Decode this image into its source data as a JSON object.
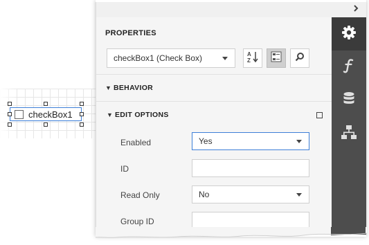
{
  "design_surface": {
    "control_label": "checkBox1"
  },
  "panel": {
    "collapse_icon": "chevron-right-icon",
    "title": "PROPERTIES",
    "object_selector": {
      "value": "checkBox1 (Check Box)"
    },
    "toolbar": {
      "sort_icon": "sort-alphabetical-icon",
      "categories_icon": "categorized-view-icon",
      "search_icon": "search-icon"
    },
    "sections": [
      {
        "name": "BEHAVIOR",
        "expanded": false
      },
      {
        "name": "EDIT OPTIONS",
        "expanded": true
      }
    ],
    "properties": [
      {
        "label": "Enabled",
        "value": "Yes",
        "type": "dropdown"
      },
      {
        "label": "ID",
        "value": "",
        "type": "text"
      },
      {
        "label": "Read Only",
        "value": "No",
        "type": "dropdown"
      },
      {
        "label": "Group ID",
        "value": "",
        "type": "text"
      }
    ],
    "rail": [
      {
        "icon": "gear-icon",
        "active": true
      },
      {
        "icon": "function-icon",
        "active": false
      },
      {
        "icon": "database-icon",
        "active": false
      },
      {
        "icon": "hierarchy-icon",
        "active": false
      }
    ]
  },
  "colors": {
    "rail_bg": "#4d4d4d",
    "rail_active": "#3b3b3b",
    "focus_border": "#3d7fd8",
    "panel_bg": "#f5f5f5"
  }
}
